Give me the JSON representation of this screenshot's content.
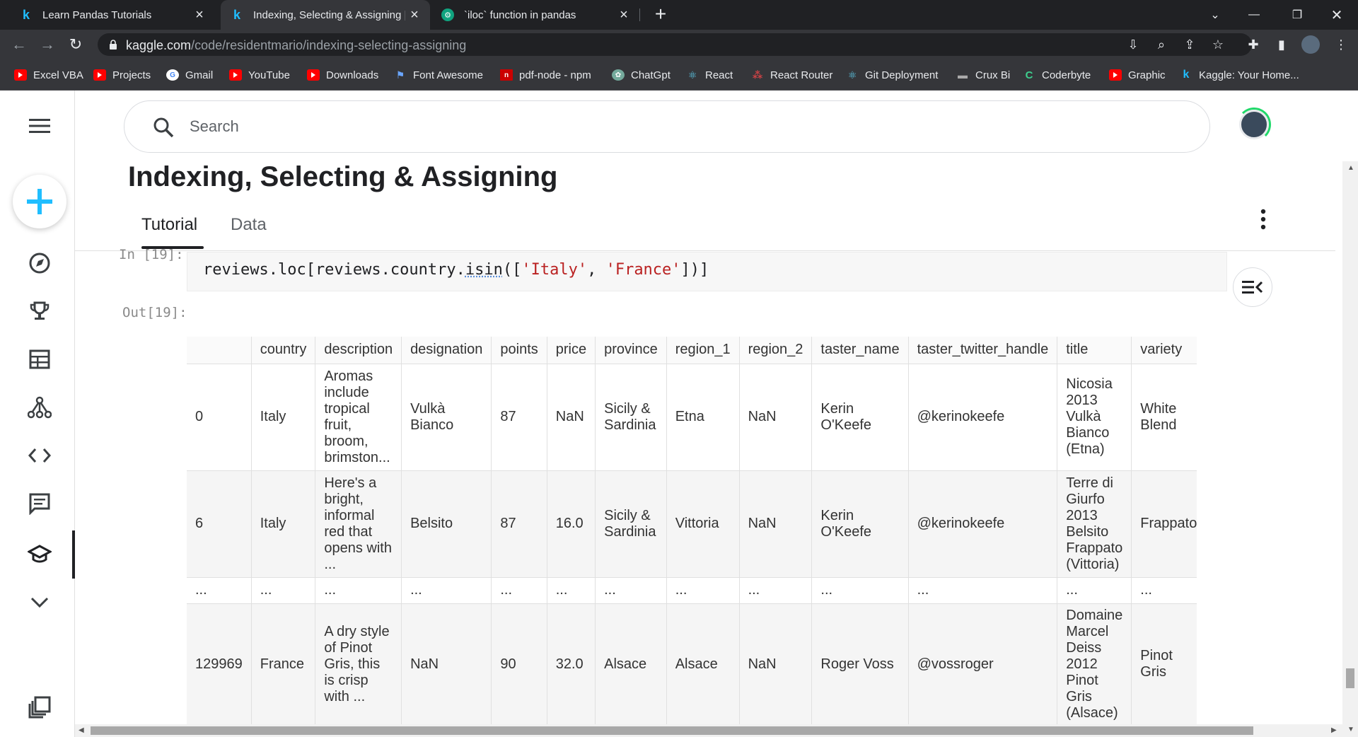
{
  "browser": {
    "tabs": [
      {
        "label": "Learn Pandas Tutorials",
        "favicon": "kaggle-k",
        "active": false
      },
      {
        "label": "Indexing, Selecting & Assigning | ",
        "favicon": "kaggle-k",
        "active": true
      },
      {
        "label": "`iloc` function in pandas",
        "favicon": "chatgpt",
        "active": false
      }
    ],
    "url_host": "kaggle.com",
    "url_path": "/code/residentmario/indexing-selecting-assigning",
    "bookmarks": [
      {
        "label": "Excel VBA",
        "icon": "youtube-icon"
      },
      {
        "label": "Projects",
        "icon": "youtube-icon"
      },
      {
        "label": "Gmail",
        "icon": "google-icon"
      },
      {
        "label": "YouTube",
        "icon": "youtube-icon"
      },
      {
        "label": "Downloads",
        "icon": "youtube-icon"
      },
      {
        "label": "Font Awesome",
        "icon": "flag-icon"
      },
      {
        "label": "pdf-node - npm",
        "icon": "npm-icon"
      },
      {
        "label": "ChatGpt",
        "icon": "chatgpt-icon"
      },
      {
        "label": "React",
        "icon": "react-icon"
      },
      {
        "label": "React Router",
        "icon": "react-router-icon"
      },
      {
        "label": "Git Deployment",
        "icon": "react-icon"
      },
      {
        "label": "Crux Bi",
        "icon": "crux-icon"
      },
      {
        "label": "Coderbyte",
        "icon": "coderbyte-icon"
      },
      {
        "label": "Graphic",
        "icon": "youtube-icon"
      },
      {
        "label": "Kaggle: Your Home...",
        "icon": "kaggle-icon"
      }
    ],
    "colors": {
      "chrome_dark": "#202124",
      "chrome_toolbar": "#35363a",
      "youtube_red": "#ff0000",
      "kaggle_blue": "#20beff"
    }
  },
  "kaggle": {
    "search_placeholder": "Search",
    "page_title": "Indexing, Selecting & Assigning",
    "tabs": [
      "Tutorial",
      "Data"
    ],
    "active_tab": "Tutorial",
    "cell": {
      "in_prompt": "In [19]:",
      "out_prompt": "Out[19]:",
      "code_prefix": "reviews.loc[reviews.country.",
      "code_fn": "isin",
      "code_mid1": "([",
      "code_str1": "'Italy'",
      "code_mid2": ", ",
      "code_str2": "'France'",
      "code_suffix": "])]"
    },
    "table": {
      "columns": [
        "",
        "country",
        "description",
        "designation",
        "points",
        "price",
        "province",
        "region_1",
        "region_2",
        "taster_name",
        "taster_twitter_handle",
        "title",
        "variety"
      ],
      "rows": [
        [
          "0",
          "Italy",
          "Aromas include tropical fruit, broom, brimston...",
          "Vulkà Bianco",
          "87",
          "NaN",
          "Sicily & Sardinia",
          "Etna",
          "NaN",
          "Kerin O'Keefe",
          "@kerinokeefe",
          "Nicosia 2013 Vulkà Bianco (Etna)",
          "White Blend"
        ],
        [
          "6",
          "Italy",
          "Here's a bright, informal red that opens with ...",
          "Belsito",
          "87",
          "16.0",
          "Sicily & Sardinia",
          "Vittoria",
          "NaN",
          "Kerin O'Keefe",
          "@kerinokeefe",
          "Terre di Giurfo 2013 Belsito Frappato (Vittoria)",
          "Frappato"
        ],
        [
          "...",
          "...",
          "...",
          "...",
          "...",
          "...",
          "...",
          "...",
          "...",
          "...",
          "...",
          "...",
          "..."
        ],
        [
          "129969",
          "France",
          "A dry style of Pinot Gris, this is crisp with ...",
          "NaN",
          "90",
          "32.0",
          "Alsace",
          "Alsace",
          "NaN",
          "Roger Voss",
          "@vossroger",
          "Domaine Marcel Deiss 2012 Pinot Gris (Alsace)",
          "Pinot Gris"
        ]
      ]
    },
    "colors": {
      "accent": "#20beff",
      "text": "#202124",
      "string": "#ba2121"
    }
  }
}
